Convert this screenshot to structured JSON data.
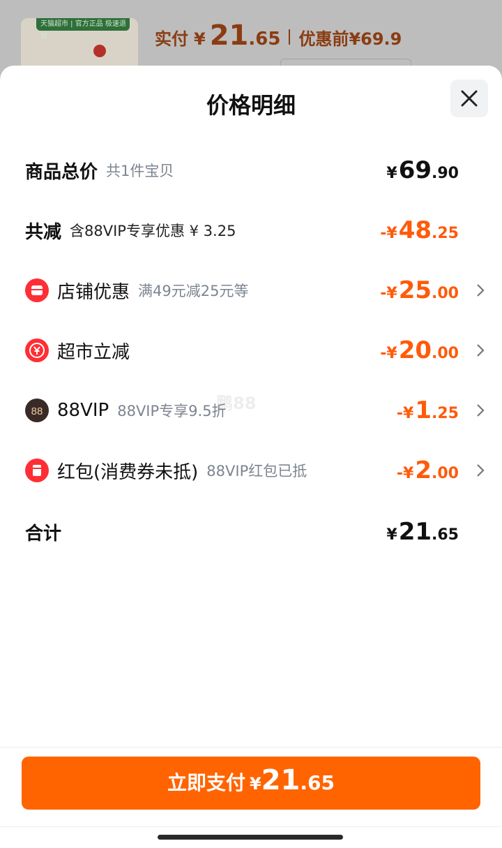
{
  "background": {
    "thumb_tag": "天猫超市 | 官方正品 极速退货",
    "paid_label": "实付",
    "paid_yen": "¥",
    "paid_int": "21",
    "paid_dec": ".65",
    "before_label": "优惠前",
    "before_value": "¥69.9"
  },
  "sheet": {
    "title": "价格明细",
    "watermark": "鹏88"
  },
  "rows": [
    {
      "main": "商品总价",
      "sub": "共1件宝贝",
      "yen": "¥",
      "int": "69",
      "dec": ".90"
    },
    {
      "main": "共减",
      "sub": "含88VIP专享优惠 ¥ 3.25",
      "yen": "-¥",
      "int": "48",
      "dec": ".25"
    },
    {
      "main": "店铺优惠",
      "sub": "满49元减25元等",
      "yen": "-¥",
      "int": "25",
      "dec": ".00",
      "icon": "shop-icon"
    },
    {
      "main": "超市立减",
      "sub": "",
      "yen": "-¥",
      "int": "20",
      "dec": ".00",
      "icon": "yen-discount-icon"
    },
    {
      "main": "88VIP",
      "sub": "88VIP专享9.5折",
      "yen": "-¥",
      "int": "1",
      "dec": ".25",
      "icon": "88vip-icon"
    },
    {
      "main": "红包(消费券未抵)",
      "sub": "88VIP红包已抵",
      "yen": "-¥",
      "int": "2",
      "dec": ".00",
      "icon": "red-packet-icon"
    },
    {
      "main": "合计",
      "sub": "",
      "yen": "¥",
      "int": "21",
      "dec": ".65"
    }
  ],
  "pay_button": {
    "label": "立即支付",
    "yen": "¥",
    "int": "21",
    "dec": ".65"
  },
  "colors": {
    "accent": "#ff6400",
    "discount": "#ff5a0a",
    "icon_red": "#ff2e34"
  }
}
